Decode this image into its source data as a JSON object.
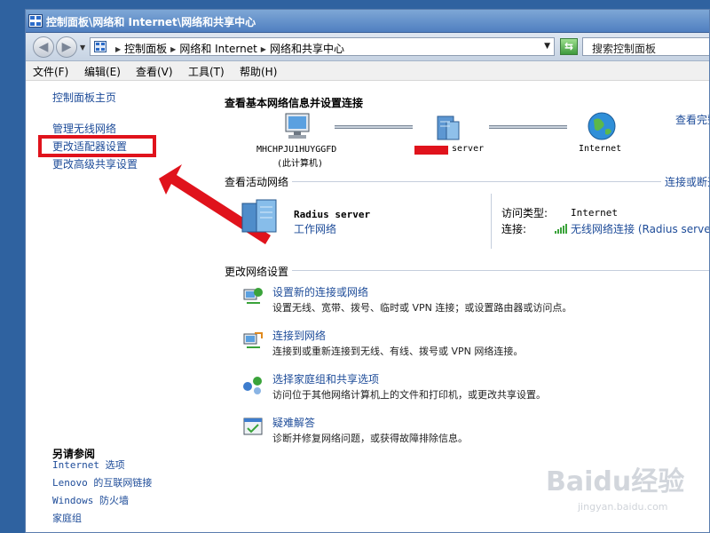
{
  "window": {
    "title": "控制面板\\网络和 Internet\\网络和共享中心"
  },
  "address": {
    "crumbs": [
      "控制面板",
      "网络和 Internet",
      "网络和共享中心"
    ],
    "search_placeholder": "搜索控制面板"
  },
  "menu": [
    "文件(F)",
    "编辑(E)",
    "查看(V)",
    "工具(T)",
    "帮助(H)"
  ],
  "sidebar": {
    "home": "控制面板主页",
    "links": [
      "管理无线网络",
      "更改适配器设置",
      "更改高级共享设置"
    ],
    "see_also_title": "另请参阅",
    "see_also": [
      "Internet 选项",
      "Lenovo 的互联网链接",
      "Windows 防火墙",
      "家庭组"
    ]
  },
  "main": {
    "title": "查看基本网络信息并设置连接",
    "view_full_map": "查看完整映射",
    "map": {
      "computer_name": "MHCHPJU1HUYGGFD",
      "computer_sub": "(此计算机)",
      "server_label": "server",
      "internet_label": "Internet"
    },
    "active": {
      "section_title": "查看活动网络",
      "connect_disconnect": "连接或断开连接",
      "network_name": "Radius server",
      "network_type": "工作网络",
      "access_type_label": "访问类型:",
      "access_type_value": "Internet",
      "connection_label": "连接:",
      "connection_value": "无线网络连接 (Radius server)"
    },
    "change": {
      "section_title": "更改网络设置",
      "tasks": [
        {
          "title": "设置新的连接或网络",
          "desc": "设置无线、宽带、拨号、临时或 VPN 连接；或设置路由器或访问点。"
        },
        {
          "title": "连接到网络",
          "desc": "连接到或重新连接到无线、有线、拨号或 VPN 网络连接。"
        },
        {
          "title": "选择家庭组和共享选项",
          "desc": "访问位于其他网络计算机上的文件和打印机，或更改共享设置。"
        },
        {
          "title": "疑难解答",
          "desc": "诊断并修复网络问题，或获得故障排除信息。"
        }
      ]
    }
  },
  "watermark": {
    "brand": "Baidu经验",
    "url": "jingyan.baidu.com"
  },
  "colors": {
    "link": "#1e4c99",
    "highlight": "#e0131c",
    "titlebar": "#4f7fc0"
  }
}
